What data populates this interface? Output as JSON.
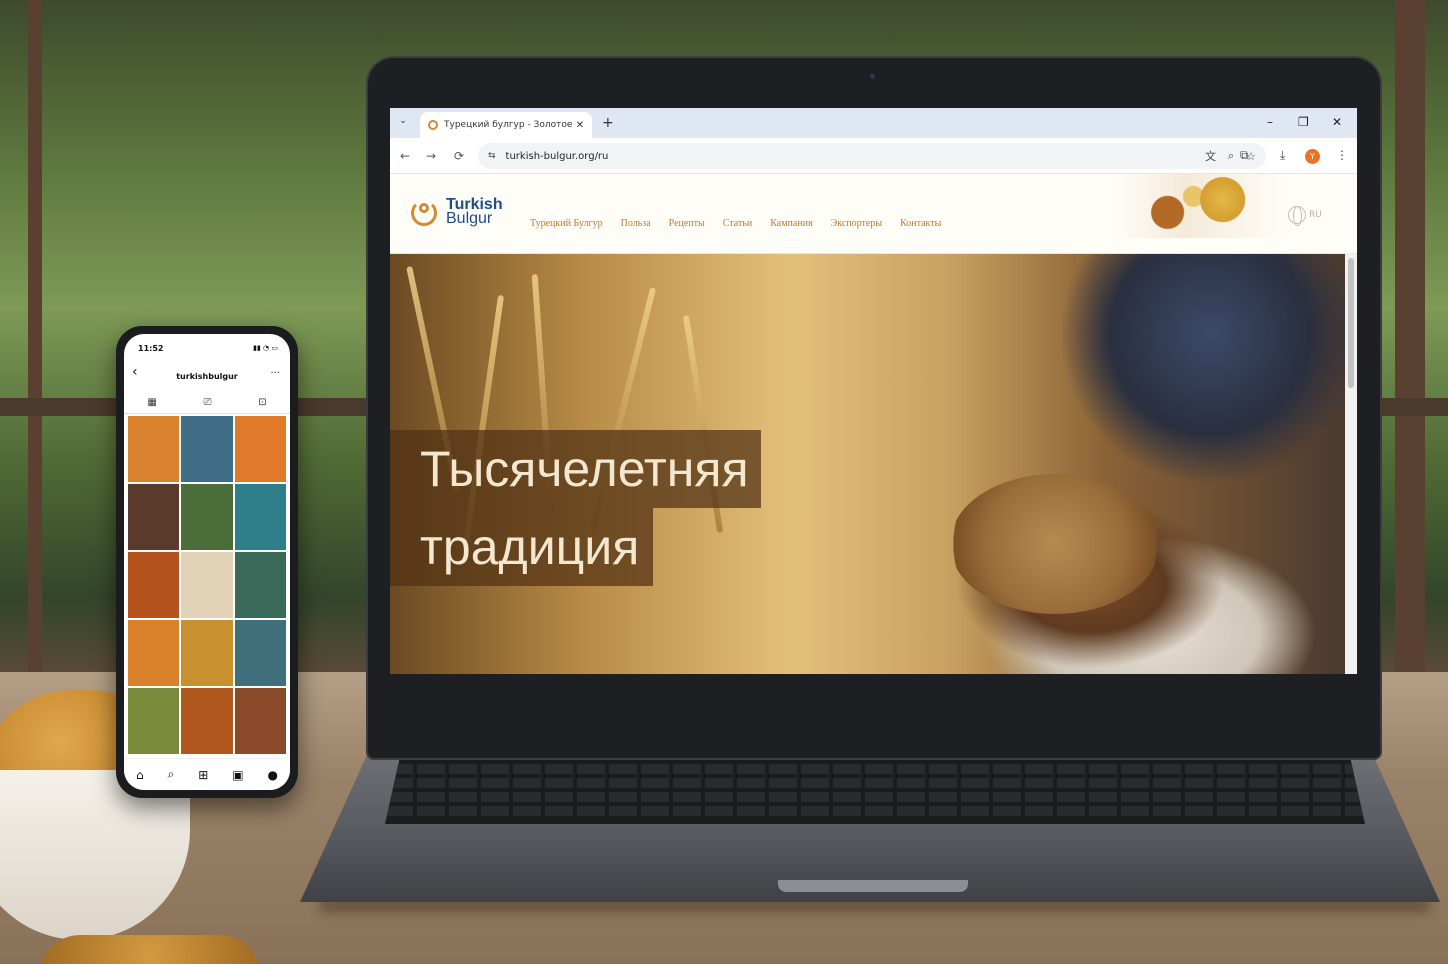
{
  "browser": {
    "tab_title": "Турецкий булгур - Золотое зе",
    "tab_close": "✕",
    "new_tab": "+",
    "tab_search": "⌄",
    "window_controls": {
      "minimize": "–",
      "restore": "❐",
      "close": "✕"
    },
    "nav": {
      "back": "←",
      "forward": "→",
      "reload": "⟳"
    },
    "site_settings_icon": "⇆",
    "url": "turkish-bulgur.org/ru",
    "omnibox_icons": [
      "translate-icon",
      "zoom-icon",
      "bookmark-star-icon"
    ],
    "extensions_icon": "⧉",
    "download_icon": "⤓",
    "profile_initial": "Y",
    "profile_color": "#e8742a",
    "menu_icon": "⋮"
  },
  "site": {
    "logo": {
      "line1": "Turkish",
      "line2": "Bulgur",
      "color": "#1f4d8c",
      "accent": "#d38a2c"
    },
    "menu": [
      "Турецкий Булгур",
      "Польза",
      "Рецепты",
      "Статьи",
      "Кампания",
      "Экспортеры",
      "Контакты"
    ],
    "menu_color": "#c27a2a",
    "language": "RU",
    "hero": {
      "line1": "Тысячелетняя",
      "line2": "традиция"
    }
  },
  "phone": {
    "time": "11:52",
    "status_icons": "▮▮ ◔ ▭",
    "back": "‹",
    "handle": "turkishbulgur",
    "more": "···",
    "tabs": [
      "▦",
      "⎚",
      "⊡"
    ],
    "grid_colors": [
      "#d9832e",
      "#3f6e86",
      "#e07a2a",
      "#5a3a2a",
      "#4a6d3a",
      "#2f7f8a",
      "#b5531f",
      "#e2d2b8",
      "#3a6a5a",
      "#d9822b",
      "#c9902f",
      "#3e6f7a",
      "#7a8a3a",
      "#b0571e",
      "#8a4a2a"
    ],
    "bottom_bar": [
      "⌂",
      "⌕",
      "⊞",
      "▣",
      "●"
    ]
  }
}
